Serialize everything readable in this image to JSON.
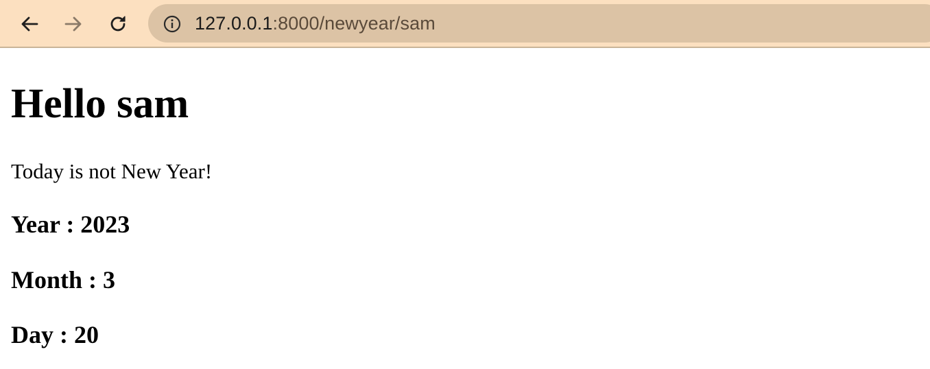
{
  "browser": {
    "url_host": "127.0.0.1",
    "url_rest": ":8000/newyear/sam",
    "icons": {
      "back": "arrow-left-icon",
      "forward": "arrow-right-icon",
      "reload": "reload-icon",
      "info": "info-icon"
    },
    "colors": {
      "toolbar_bg": "#fce0c0",
      "omnibox_bg": "#dcc3a5"
    }
  },
  "page": {
    "heading": "Hello sam",
    "message": "Today is not New Year!",
    "year_line": "Year : 2023",
    "month_line": "Month : 3",
    "day_line": "Day : 20"
  }
}
